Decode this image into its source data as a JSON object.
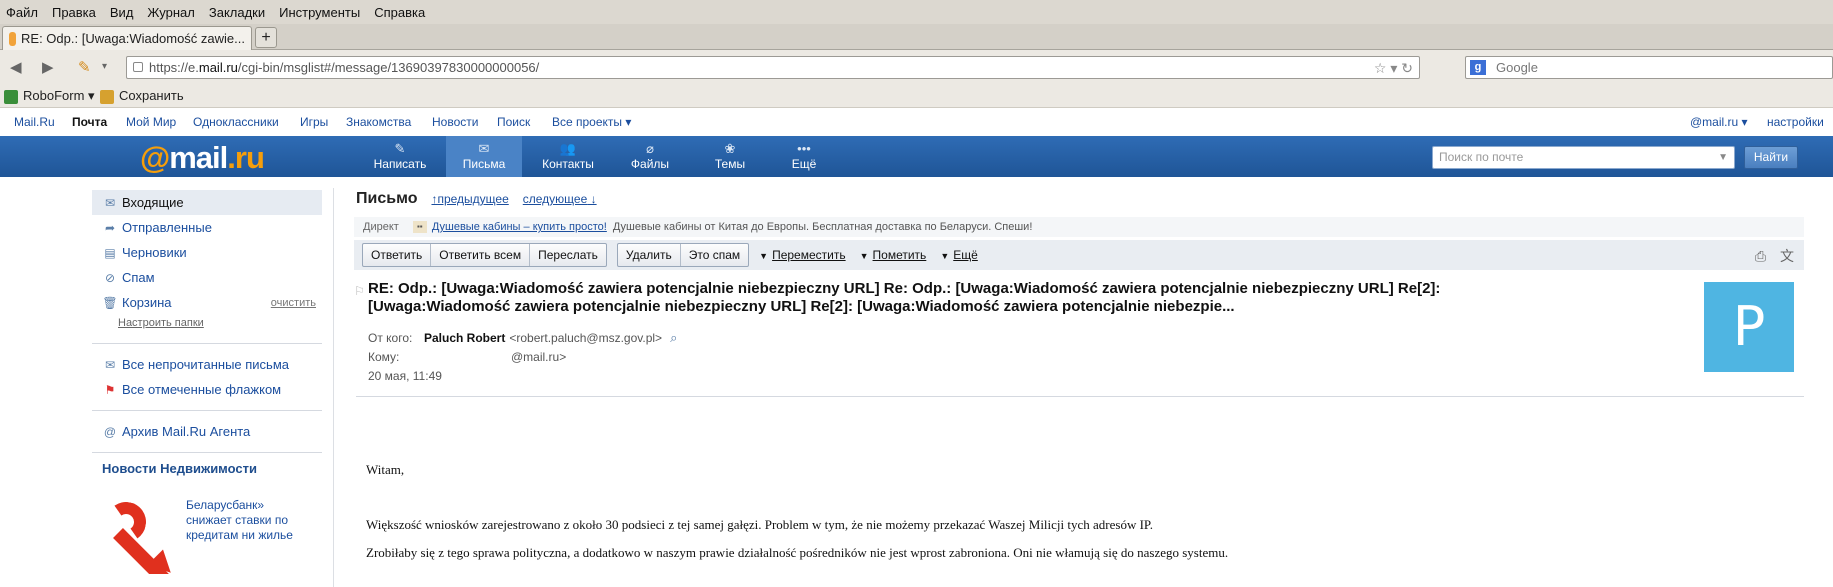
{
  "browser": {
    "menu": [
      "Файл",
      "Правка",
      "Вид",
      "Журнал",
      "Закладки",
      "Инструменты",
      "Справка"
    ],
    "tab_title": "RE: Odp.: [Uwaga:Wiadomość zawie...",
    "new_tab": "+",
    "url_prefix": "https://e.",
    "url_host": "mail.ru",
    "url_path": "/cgi-bin/msglist#/message/13690397830000000056/",
    "search_placeholder": "Google",
    "search_engine": "g-icon",
    "bookmarks": [
      "RoboForm",
      "Сохранить"
    ]
  },
  "portal": {
    "links": [
      "Mail.Ru",
      "Почта",
      "Мой Мир",
      "Одноклассники",
      "Игры",
      "Знакомства",
      "Новости",
      "Поиск",
      "Все проекты"
    ],
    "active": "Почта",
    "account": "@mail.ru",
    "settings": "настройки"
  },
  "header": {
    "logo_at": "@",
    "logo_text": "mail",
    "logo_dot": ".",
    "logo_tld": "ru",
    "nav": [
      {
        "label": "Написать",
        "icon": "pencil-icon"
      },
      {
        "label": "Письма",
        "icon": "envelope-icon"
      },
      {
        "label": "Контакты",
        "icon": "contacts-icon"
      },
      {
        "label": "Файлы",
        "icon": "paperclip-icon"
      },
      {
        "label": "Темы",
        "icon": "palette-icon"
      },
      {
        "label": "Ещё",
        "icon": "more-icon"
      }
    ],
    "active_nav": "Письма",
    "search_placeholder": "Поиск по почте",
    "find_label": "Найти",
    "bg_color": "#2f6cb5",
    "accent": "#f59e0b"
  },
  "sidebar": {
    "folders": [
      {
        "label": "Входящие",
        "icon": "inbox-icon"
      },
      {
        "label": "Отправленные",
        "icon": "sent-icon"
      },
      {
        "label": "Черновики",
        "icon": "drafts-icon"
      },
      {
        "label": "Спам",
        "icon": "spam-icon"
      },
      {
        "label": "Корзина",
        "icon": "trash-icon"
      }
    ],
    "clear_label": "очистить",
    "setup_label": "Настроить папки",
    "filters": [
      "Все непрочитанные письма",
      "Все отмеченные флажком"
    ],
    "archive_label": "Архив Mail.Ru Агента",
    "news_title": "Новости Недвижимости",
    "ad_text": "Беларусбанк» снижает ставки по кредитам ни жилье"
  },
  "message": {
    "heading": "Письмо",
    "prev": "предыдущее",
    "next": "следующее",
    "direct_label": "Директ",
    "direct_link": "Душевые кабины – купить просто!",
    "direct_text": "Душевые кабины от Китая до Европы. Бесплатная доставка по Беларуси. Спеши!",
    "toolbar_group1": [
      "Ответить",
      "Ответить всем",
      "Переслать"
    ],
    "toolbar_group2": [
      "Удалить",
      "Это спам"
    ],
    "toolbar_dropdowns": [
      "Переместить",
      "Пометить",
      "Ещё"
    ],
    "subject_line1": "RE: Odp.: [Uwaga:Wiadomość zawiera potencjalnie niebezpieczny URL] Re: Odp.: [Uwaga:Wiadomość zawiera potencjalnie niebezpieczny URL] Re[2]:",
    "subject_line2": "[Uwaga:Wiadomość zawiera potencjalnie niebezpieczny URL] Re[2]: [Uwaga:Wiadomość zawiera potencjalnie niebezpie...",
    "from_label": "От кого:",
    "from_name": "Paluch Robert",
    "from_email": "<robert.paluch@msz.gov.pl>",
    "to_label": "Кому:",
    "to_email": "@mail.ru>",
    "date": "20 мая, 11:49",
    "avatar_letter": "P",
    "avatar_color": "#4fb5e2",
    "body": [
      "Witam,",
      "Większość wniosków zarejestrowano z około 30 podsieci z tej samej gałęzi. Problem w tym, że nie możemy przekazać Waszej Milicji tych adresów IP.",
      "Zrobiłaby się z tego sprawa polityczna, a dodatkowo w naszym prawie działalność pośredników nie jest wprost zabroniona. Oni nie włamują się do naszego systemu."
    ]
  }
}
